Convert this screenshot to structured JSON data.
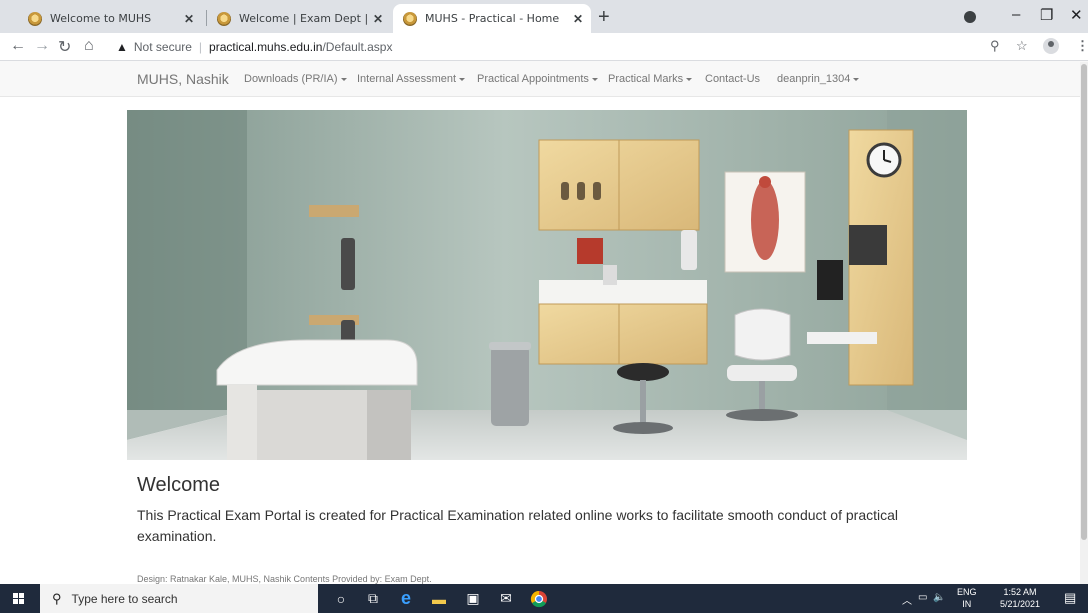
{
  "browser": {
    "tabs": [
      {
        "title": "Welcome to MUHS",
        "active": false
      },
      {
        "title": "Welcome | Exam Dept | MUHS",
        "active": false
      },
      {
        "title": "MUHS - Practical - Home",
        "active": true
      }
    ],
    "security_label": "Not secure",
    "url_host": "practical.muhs.edu.in",
    "url_path": "/Default.aspx"
  },
  "navbar": {
    "brand": "MUHS, Nashik",
    "items": [
      {
        "label": "Downloads (PR/IA)",
        "dropdown": true
      },
      {
        "label": "Internal Assessment",
        "dropdown": true
      },
      {
        "label": "Practical Appointments",
        "dropdown": true
      },
      {
        "label": "Practical Marks",
        "dropdown": true
      },
      {
        "label": "Contact-Us",
        "dropdown": false
      },
      {
        "label": "deanprin_1304",
        "dropdown": true
      }
    ]
  },
  "main": {
    "welcome_title": "Welcome",
    "welcome_text": "This Practical Exam Portal is created for Practical Examination related online works to facilitate smooth conduct of practical examination."
  },
  "footer": {
    "text": "Design: Ratnakar Kale, MUHS, Nashik    Contents Provided by: Exam Dept."
  },
  "taskbar": {
    "search_placeholder": "Type here to search",
    "lang_top": "ENG",
    "lang_bottom": "IN",
    "time": "1:52 AM",
    "date": "5/21/2021"
  },
  "icons": {
    "back": "back-arrow-icon",
    "forward": "forward-arrow-icon",
    "reload": "reload-icon",
    "home": "home-icon",
    "zoom": "zoom-icon",
    "bookmark": "star-icon",
    "menu": "kebab-menu-icon"
  }
}
